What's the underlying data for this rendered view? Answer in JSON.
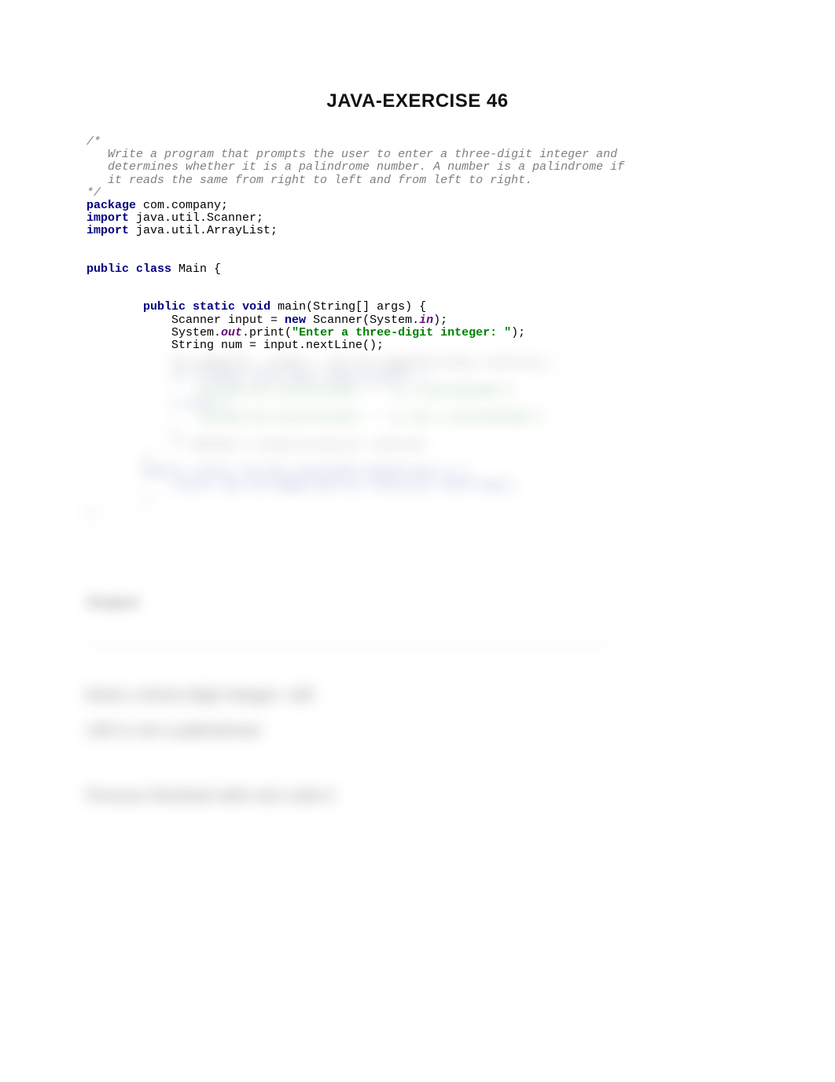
{
  "title": "JAVA-EXERCISE 46",
  "code": {
    "comment_open": "/*",
    "comment_l1": "   Write a program that prompts the user to enter a three-digit integer and",
    "comment_l2": "   determines whether it is a palindrome number. A number is a palindrome if",
    "comment_l3": "   it reads the same from right to left and from left to right.",
    "comment_close": "*/",
    "kw_package": "package",
    "pkg": " com.company;",
    "kw_import1": "import",
    "imp1": " java.util.Scanner;",
    "kw_import2": "import",
    "imp2": " java.util.ArrayList;",
    "kw_public": "public",
    "kw_class": "class",
    "classdecl": " Main {",
    "kw_public2": "public",
    "kw_static": "static",
    "kw_void": "void",
    "mainhead": " main(String[] args) {",
    "sc1a": "            Scanner input = ",
    "kw_new": "new",
    "sc1b": " Scanner(System.",
    "fld_in": "in",
    "sc1c": ");",
    "sc2a": "            System.",
    "fld_out": "out",
    "sc2b": ".print(",
    "str_prompt": "\"Enter a three-digit integer: \"",
    "sc2c": ");",
    "sc3": "            String num = input.nextLine();"
  },
  "blurred": {
    "l1": "            StringBuffer revNum = new StringBuffer(num).reverse();",
    "l2": "            if (revNum.toString().equals(num)) {",
    "l3": "                System.out.println(num + \" is a palindrome\");",
    "l4": "            } else {",
    "l5": "                System.out.println(num + \" is not a palindrome\");",
    "l6": "            }",
    "l7": "            // Method 2 using ArrayList reversal",
    "l8": "        }",
    "l9": "        public static String reverseString(String s) {",
    "l10": "            return new StringBuilder(s).reverse().toString();",
    "l11": "        }",
    "l12": "}"
  },
  "output": {
    "heading": "Output",
    "dashes": "--------------------------------------------------------------------------",
    "line1": "Enter a three-digit integer: 145",
    "line2": "145 is not a palindrome",
    "line3": "Process finished with exit code 0"
  }
}
